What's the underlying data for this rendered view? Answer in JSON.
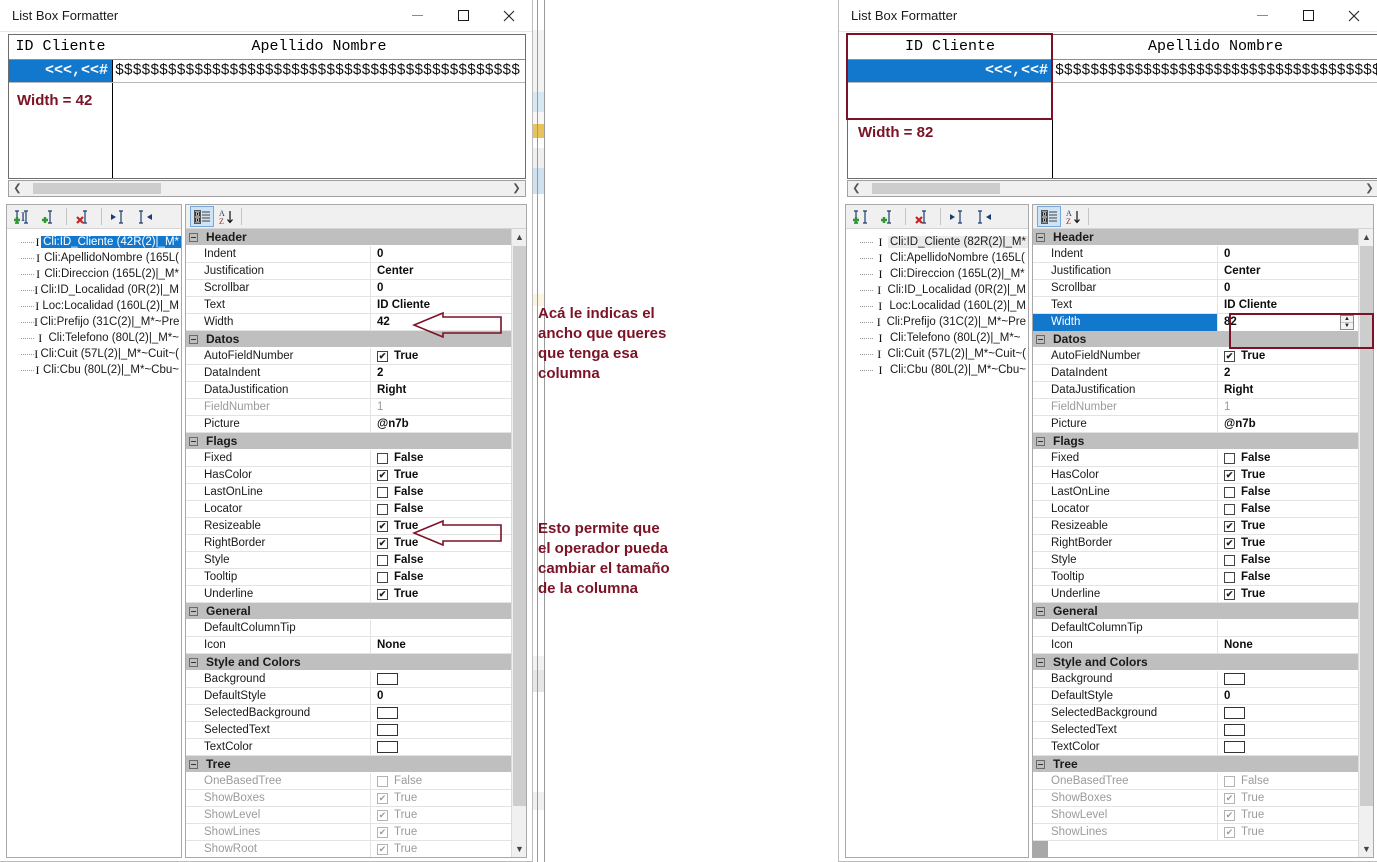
{
  "window_title": "List Box Formatter",
  "window_buttons": {
    "minimize": "minimize-button",
    "maximize": "maximize-button",
    "close": "close-button"
  },
  "left": {
    "listbox": {
      "col1_header": "ID Cliente",
      "col2_header": "Apellido Nombre",
      "col1_value": "<<<,<<#",
      "col2_value": "$$$$$$$$$$$$$$$$$$$$$$$$$$$$$$$$$$$$$$$$$$$$$$",
      "width_label": "Width = 42"
    },
    "tree_items": [
      "Cli:ID_Cliente (42R(2)|_M*",
      "Cli:ApellidoNombre (165L(",
      "Cli:Direccion (165L(2)|_M*",
      "Cli:ID_Localidad (0R(2)|_M",
      "Loc:Localidad (160L(2)|_M",
      "Cli:Prefijo (31C(2)|_M*~Pre",
      "Cli:Telefono (80L(2)|_M*~",
      "Cli:Cuit (57L(2)|_M*~Cuit~(",
      "Cli:Cbu (80L(2)|_M*~Cbu~"
    ],
    "selected_tree_index": 0,
    "properties": [
      {
        "kind": "category",
        "label": "Header"
      },
      {
        "kind": "row",
        "name": "Indent",
        "value": "0",
        "type": "text"
      },
      {
        "kind": "row",
        "name": "Justification",
        "value": "Center",
        "type": "text"
      },
      {
        "kind": "row",
        "name": "Scrollbar",
        "value": "0",
        "type": "text"
      },
      {
        "kind": "row",
        "name": "Text",
        "value": "ID Cliente",
        "type": "text",
        "rowhl": true
      },
      {
        "kind": "row",
        "name": "Width",
        "value": "42",
        "type": "text"
      },
      {
        "kind": "category",
        "label": "Datos"
      },
      {
        "kind": "row",
        "name": "AutoFieldNumber",
        "value": "True",
        "type": "check",
        "checked": true
      },
      {
        "kind": "row",
        "name": "DataIndent",
        "value": "2",
        "type": "text"
      },
      {
        "kind": "row",
        "name": "DataJustification",
        "value": "Right",
        "type": "text"
      },
      {
        "kind": "row",
        "name": "FieldNumber",
        "value": "1",
        "type": "text",
        "dim": true
      },
      {
        "kind": "row",
        "name": "Picture",
        "value": "@n7b",
        "type": "text"
      },
      {
        "kind": "category",
        "label": "Flags"
      },
      {
        "kind": "row",
        "name": "Fixed",
        "value": "False",
        "type": "check",
        "checked": false
      },
      {
        "kind": "row",
        "name": "HasColor",
        "value": "True",
        "type": "check",
        "checked": true
      },
      {
        "kind": "row",
        "name": "LastOnLine",
        "value": "False",
        "type": "check",
        "checked": false
      },
      {
        "kind": "row",
        "name": "Locator",
        "value": "False",
        "type": "check",
        "checked": false
      },
      {
        "kind": "row",
        "name": "Resizeable",
        "value": "True",
        "type": "check",
        "checked": true
      },
      {
        "kind": "row",
        "name": "RightBorder",
        "value": "True",
        "type": "check",
        "checked": true
      },
      {
        "kind": "row",
        "name": "Style",
        "value": "False",
        "type": "check",
        "checked": false
      },
      {
        "kind": "row",
        "name": "Tooltip",
        "value": "False",
        "type": "check",
        "checked": false
      },
      {
        "kind": "row",
        "name": "Underline",
        "value": "True",
        "type": "check",
        "checked": true
      },
      {
        "kind": "category",
        "label": "General"
      },
      {
        "kind": "row",
        "name": "DefaultColumnTip",
        "value": "",
        "type": "text"
      },
      {
        "kind": "row",
        "name": "Icon",
        "value": "None",
        "type": "text"
      },
      {
        "kind": "category",
        "label": "Style and Colors"
      },
      {
        "kind": "row",
        "name": "Background",
        "value": "",
        "type": "color"
      },
      {
        "kind": "row",
        "name": "DefaultStyle",
        "value": "0",
        "type": "text"
      },
      {
        "kind": "row",
        "name": "SelectedBackground",
        "value": "",
        "type": "color"
      },
      {
        "kind": "row",
        "name": "SelectedText",
        "value": "",
        "type": "color"
      },
      {
        "kind": "row",
        "name": "TextColor",
        "value": "",
        "type": "color"
      },
      {
        "kind": "category",
        "label": "Tree"
      },
      {
        "kind": "row",
        "name": "OneBasedTree",
        "value": "False",
        "type": "check",
        "checked": false,
        "dim": true
      },
      {
        "kind": "row",
        "name": "ShowBoxes",
        "value": "True",
        "type": "check",
        "checked": true,
        "dim": true
      },
      {
        "kind": "row",
        "name": "ShowLevel",
        "value": "True",
        "type": "check",
        "checked": true,
        "dim": true
      },
      {
        "kind": "row",
        "name": "ShowLines",
        "value": "True",
        "type": "check",
        "checked": true,
        "dim": true
      },
      {
        "kind": "row",
        "name": "ShowRoot",
        "value": "True",
        "type": "check",
        "checked": true,
        "dim": true
      }
    ]
  },
  "right": {
    "listbox": {
      "col1_header": "ID Cliente",
      "col2_header": "Apellido Nombre",
      "col1_value": "<<<,<<#",
      "col2_value": "$$$$$$$$$$$$$$$$$$$$$$$$$$$$$$$$$$$$$$$$$$$$$$",
      "width_label": "Width = 82"
    },
    "tree_items": [
      "Cli:ID_Cliente (82R(2)|_M*",
      "Cli:ApellidoNombre (165L(",
      "Cli:Direccion (165L(2)|_M*",
      "Cli:ID_Localidad (0R(2)|_M",
      "Loc:Localidad (160L(2)|_M",
      "Cli:Prefijo (31C(2)|_M*~Pre",
      "Cli:Telefono (80L(2)|_M*~",
      "Cli:Cuit (57L(2)|_M*~Cuit~(",
      "Cli:Cbu (80L(2)|_M*~Cbu~"
    ],
    "selected_tree_index": 0,
    "properties": [
      {
        "kind": "category",
        "label": "Header"
      },
      {
        "kind": "row",
        "name": "Indent",
        "value": "0",
        "type": "text"
      },
      {
        "kind": "row",
        "name": "Justification",
        "value": "Center",
        "type": "text"
      },
      {
        "kind": "row",
        "name": "Scrollbar",
        "value": "0",
        "type": "text"
      },
      {
        "kind": "row",
        "name": "Text",
        "value": "ID Cliente",
        "type": "text"
      },
      {
        "kind": "row",
        "name": "Width",
        "value": "82",
        "type": "spinner",
        "selected": true
      },
      {
        "kind": "category",
        "label": "Datos"
      },
      {
        "kind": "row",
        "name": "AutoFieldNumber",
        "value": "True",
        "type": "check",
        "checked": true
      },
      {
        "kind": "row",
        "name": "DataIndent",
        "value": "2",
        "type": "text"
      },
      {
        "kind": "row",
        "name": "DataJustification",
        "value": "Right",
        "type": "text"
      },
      {
        "kind": "row",
        "name": "FieldNumber",
        "value": "1",
        "type": "text",
        "dim": true
      },
      {
        "kind": "row",
        "name": "Picture",
        "value": "@n7b",
        "type": "text"
      },
      {
        "kind": "category",
        "label": "Flags"
      },
      {
        "kind": "row",
        "name": "Fixed",
        "value": "False",
        "type": "check",
        "checked": false
      },
      {
        "kind": "row",
        "name": "HasColor",
        "value": "True",
        "type": "check",
        "checked": true
      },
      {
        "kind": "row",
        "name": "LastOnLine",
        "value": "False",
        "type": "check",
        "checked": false
      },
      {
        "kind": "row",
        "name": "Locator",
        "value": "False",
        "type": "check",
        "checked": false
      },
      {
        "kind": "row",
        "name": "Resizeable",
        "value": "True",
        "type": "check",
        "checked": true
      },
      {
        "kind": "row",
        "name": "RightBorder",
        "value": "True",
        "type": "check",
        "checked": true
      },
      {
        "kind": "row",
        "name": "Style",
        "value": "False",
        "type": "check",
        "checked": false
      },
      {
        "kind": "row",
        "name": "Tooltip",
        "value": "False",
        "type": "check",
        "checked": false
      },
      {
        "kind": "row",
        "name": "Underline",
        "value": "True",
        "type": "check",
        "checked": true
      },
      {
        "kind": "category",
        "label": "General"
      },
      {
        "kind": "row",
        "name": "DefaultColumnTip",
        "value": "",
        "type": "text"
      },
      {
        "kind": "row",
        "name": "Icon",
        "value": "None",
        "type": "text"
      },
      {
        "kind": "category",
        "label": "Style and Colors"
      },
      {
        "kind": "row",
        "name": "Background",
        "value": "",
        "type": "color"
      },
      {
        "kind": "row",
        "name": "DefaultStyle",
        "value": "0",
        "type": "text"
      },
      {
        "kind": "row",
        "name": "SelectedBackground",
        "value": "",
        "type": "color"
      },
      {
        "kind": "row",
        "name": "SelectedText",
        "value": "",
        "type": "color"
      },
      {
        "kind": "row",
        "name": "TextColor",
        "value": "",
        "type": "color"
      },
      {
        "kind": "category",
        "label": "Tree"
      },
      {
        "kind": "row",
        "name": "OneBasedTree",
        "value": "False",
        "type": "check",
        "checked": false,
        "dim": true
      },
      {
        "kind": "row",
        "name": "ShowBoxes",
        "value": "True",
        "type": "check",
        "checked": true,
        "dim": true
      },
      {
        "kind": "row",
        "name": "ShowLevel",
        "value": "True",
        "type": "check",
        "checked": true,
        "dim": true
      },
      {
        "kind": "row",
        "name": "ShowLines",
        "value": "True",
        "type": "check",
        "checked": true,
        "dim": true
      }
    ]
  },
  "annotations": {
    "width_note": "Acá le indicas el\nancho que queres\nque tenga esa\ncolumna",
    "resize_note": "Esto permite que\nel operador pueda\ncambiar el tamaño\nde la columna",
    "accent_color": "#7b1225"
  },
  "toolbar_icons": {
    "add_left": "insert-column-left-icon",
    "add_right": "insert-column-right-icon",
    "delete": "delete-column-icon",
    "move_left": "move-column-left-icon",
    "move_right": "move-column-right-icon",
    "categorized": "categorized-view-icon",
    "alphabetical": "alphabetical-sort-icon"
  }
}
